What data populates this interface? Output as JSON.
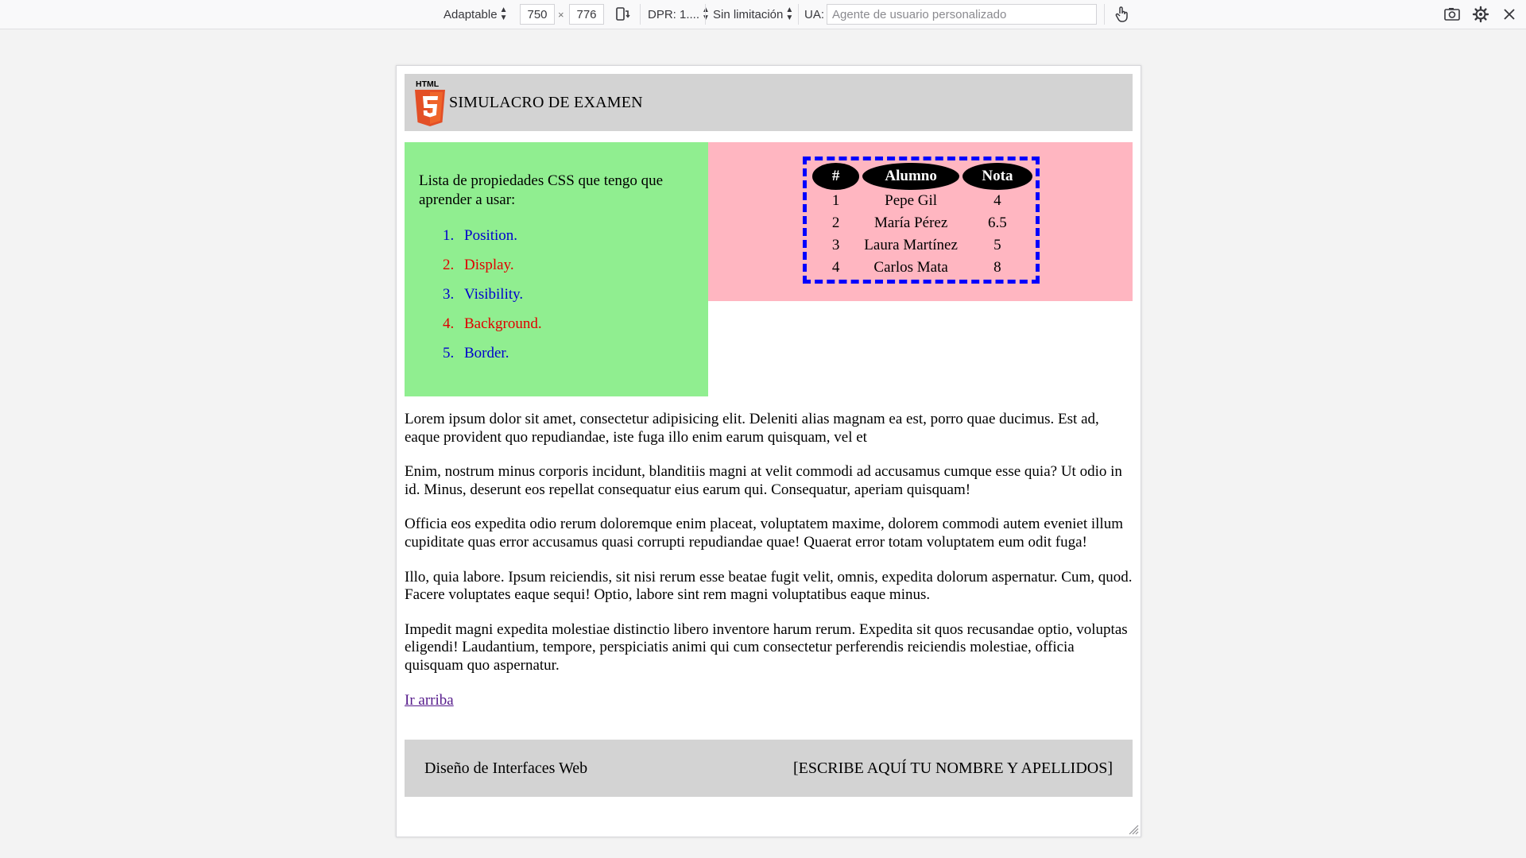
{
  "toolbar": {
    "device": "Adaptable",
    "width": "750",
    "times": "×",
    "height": "776",
    "dpr": "DPR: 1....",
    "throttling": "Sin limitación",
    "ua_label": "UA:",
    "ua_placeholder": "Agente de usuario personalizado",
    "icons": [
      "rotate-icon",
      "touch-icon",
      "screenshot-icon",
      "settings-icon",
      "close-icon"
    ]
  },
  "header": {
    "logo_text": "HTML",
    "title": "SIMULACRO DE EXAMEN"
  },
  "aside": {
    "intro": "Lista de propiedades CSS que tengo que aprender a usar:",
    "items": [
      {
        "num": "1.",
        "label": "Position.",
        "color": "#0000cd"
      },
      {
        "num": "2.",
        "label": "Display.",
        "color": "#e00000"
      },
      {
        "num": "3.",
        "label": "Visibility.",
        "color": "#0000cd"
      },
      {
        "num": "4.",
        "label": "Background.",
        "color": "#e00000"
      },
      {
        "num": "5.",
        "label": "Border.",
        "color": "#0000cd"
      }
    ]
  },
  "table": {
    "headers": [
      "#",
      "Alumno",
      "Nota"
    ],
    "rows": [
      [
        "1",
        "Pepe Gil",
        "4"
      ],
      [
        "2",
        "María Pérez",
        "6.5"
      ],
      [
        "3",
        "Laura Martínez",
        "5"
      ],
      [
        "4",
        "Carlos Mata",
        "8"
      ]
    ]
  },
  "paragraphs": [
    "Lorem ipsum dolor sit amet, consectetur adipisicing elit. Deleniti alias magnam ea est, porro quae ducimus. Est ad, eaque provident quo repudiandae, iste fuga illo enim earum quisquam, vel et",
    "Enim, nostrum minus corporis incidunt, blanditiis magni at velit commodi ad accusamus cumque esse quia? Ut odio in id. Minus, deserunt eos repellat consequatur eius earum qui. Consequatur, aperiam quisquam!",
    "Officia eos expedita odio rerum doloremque enim placeat, voluptatem maxime, dolorem commodi autem eveniet illum cupiditate quas error accusamus quasi corrupti repudiandae quae! Quaerat error totam voluptatem eum odit fuga!",
    "Illo, quia labore. Ipsum reiciendis, sit nisi rerum esse beatae fugit velit, omnis, expedita dolorum aspernatur. Cum, quod. Facere voluptates eaque sequi! Optio, labore sint rem magni voluptatibus eaque minus.",
    "Impedit magni expedita molestiae distinctio libero inventore harum rerum. Expedita sit quos recusandae optio, voluptas eligendi! Laudantium, tempore, perspiciatis animi qui cum consectetur perferendis reiciendis molestiae, officia quisquam quo aspernatur."
  ],
  "link": {
    "label": "Ir arriba"
  },
  "footer": {
    "left": "Diseño de Interfaces Web",
    "right": "[ESCRIBE AQUÍ TU NOMBRE Y APELLIDOS]"
  },
  "colors": {
    "header_bg": "#d3d3d3",
    "aside_bg": "#90ee90",
    "table_box_bg": "#ffb6c1",
    "table_border": "#0000ff",
    "link": "#551a8b"
  }
}
